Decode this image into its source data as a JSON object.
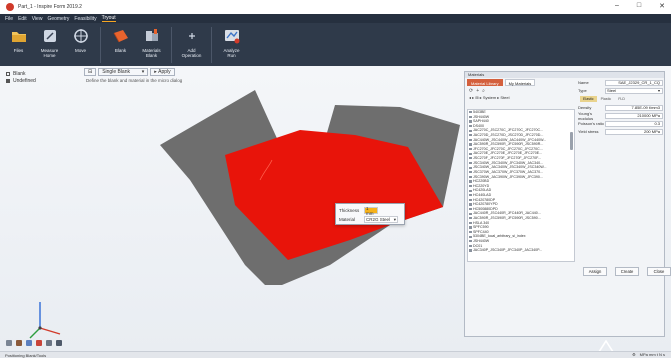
{
  "window": {
    "title": "Part_1 - Inspire Form 2019.2",
    "min": "–",
    "max": "□",
    "close": "✕"
  },
  "menu": [
    "File",
    "Edit",
    "View",
    "Geometry",
    "Feasibility",
    "Tryout"
  ],
  "ribbon": [
    {
      "label": "Files"
    },
    {
      "label": "Measure\nHome"
    },
    {
      "label": "Move"
    },
    {
      "label": "Blank"
    },
    {
      "label": "Materials\nBlank"
    },
    {
      "label": "Add\nOperation"
    },
    {
      "label": "Analyze\nRun"
    }
  ],
  "browser": {
    "items": [
      "Blank",
      "Undefined"
    ]
  },
  "guide": {
    "mode": "Single Blank",
    "apply": "Apply",
    "hint": "Define the blank and material in the micro dialog"
  },
  "popup": {
    "thickness_label": "Thickness",
    "thickness_value": "1 mm",
    "material_label": "Material",
    "material_value": "CR2G Steel"
  },
  "material_panel": {
    "header": "Materials",
    "tabs": [
      "Material Library",
      "My Materials"
    ],
    "breadcrumb": "◂ ▸ ⊞ ▸ System ▸ Steel",
    "list": [
      "5403BE",
      "JSH440W",
      "SAPH440",
      "DS400",
      "JAC270C_JSC270C_JFC270C_JFC270C...",
      "JAC270D_JSC270D_JSC270D_JFC270D...",
      "JAC440W_JSC440W_JAC440W_JFC440W...",
      "JAC590R_JSC590R_JFC590R_JSC590R...",
      "JFC270C_JFC270C_JFC270C_JFC270C...",
      "JAC270E_JFC270E_JFC270E_JFC270E...",
      "JSC270F_JFC270F_JFC270F_JFC270F...",
      "JSC340W_JSC340W_JFC340W_JAC340...",
      "JSC340W_JAC340W_JSC340W_JSC340W...",
      "JSC370W_JAC370W_JFC370W_JAC370...",
      "JSC390W_JAC390W_JFC390W_JFC390...",
      "HC220BD",
      "HC220YD",
      "HC420LAD",
      "HC440LAD",
      "HC420780DP",
      "HC420780YPD",
      "HC500880DPD",
      "JAC440R_JSC440R_JFC440R_JAC440...",
      "JAC590R_JSC590R_JFC590R_JSC590...",
      "HSLA 340",
      "SPFC590",
      "SPFC440",
      "5304BE_local_arbitrary_si_index",
      "JSH440W",
      "DC01",
      "JAC340P_JSC340P_JFC340P_JAC340P..."
    ],
    "props": {
      "name_label": "Name",
      "name_value": "SAE_J2329_CR_1_CQ",
      "type_label": "Type",
      "type_value": "Steel",
      "sub_tabs": [
        "Elastic",
        "Plastic",
        "FLD"
      ],
      "rows": [
        {
          "label": "Density",
          "value": "7.85E-09 t/mm3"
        },
        {
          "label": "Young's modulus",
          "value": "210000 MPa"
        },
        {
          "label": "Poisson's ratio",
          "value": "0.3"
        },
        {
          "label": "Yield stress",
          "value": "200 MPa"
        }
      ]
    },
    "buttons": [
      "Assign",
      "Create",
      "Close"
    ]
  },
  "status": {
    "text": "Positioning Blank/Tools",
    "units": "MPa mm t N s"
  },
  "colors": {
    "part": "#e01208",
    "die": "#707070",
    "accent": "#f6a623",
    "ribbon": "#2f3a4a"
  }
}
